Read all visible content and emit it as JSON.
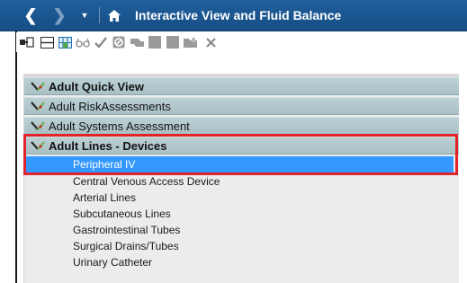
{
  "window": {
    "title": "Interactive View and Fluid Balance"
  },
  "icons": {
    "back": "chevron-left-icon",
    "forward": "chevron-right-icon",
    "dropdown": "dropdown-arrow-icon",
    "home": "home-icon"
  },
  "toolbar": {
    "icons": [
      "insert-column-icon",
      "table-icon",
      "grid-icon",
      "glasses-icon",
      "checkmark-icon",
      "no-icon",
      "flag-icon",
      "document-icon",
      "document-icon",
      "folder-icon",
      "close-icon"
    ]
  },
  "sections": [
    {
      "label": "Adult Quick View",
      "bold": true
    },
    {
      "label": "Adult RiskAssessments",
      "bold": false
    },
    {
      "label": "Adult Systems Assessment",
      "bold": false
    },
    {
      "label": "Adult Lines - Devices",
      "bold": true
    }
  ],
  "items": [
    {
      "label": "Peripheral IV",
      "selected": true
    },
    {
      "label": "Central Venous Access Device",
      "selected": false
    },
    {
      "label": "Arterial Lines",
      "selected": false
    },
    {
      "label": "Subcutaneous Lines",
      "selected": false
    },
    {
      "label": "Gastrointestinal Tubes",
      "selected": false
    },
    {
      "label": "Surgical Drains/Tubes",
      "selected": false
    },
    {
      "label": "Urinary Catheter",
      "selected": false
    }
  ],
  "colors": {
    "titlebar": "#1f5f9c",
    "section": "#bcd0d4",
    "selection": "#3399ff",
    "highlight_frame": "#e0242a"
  }
}
